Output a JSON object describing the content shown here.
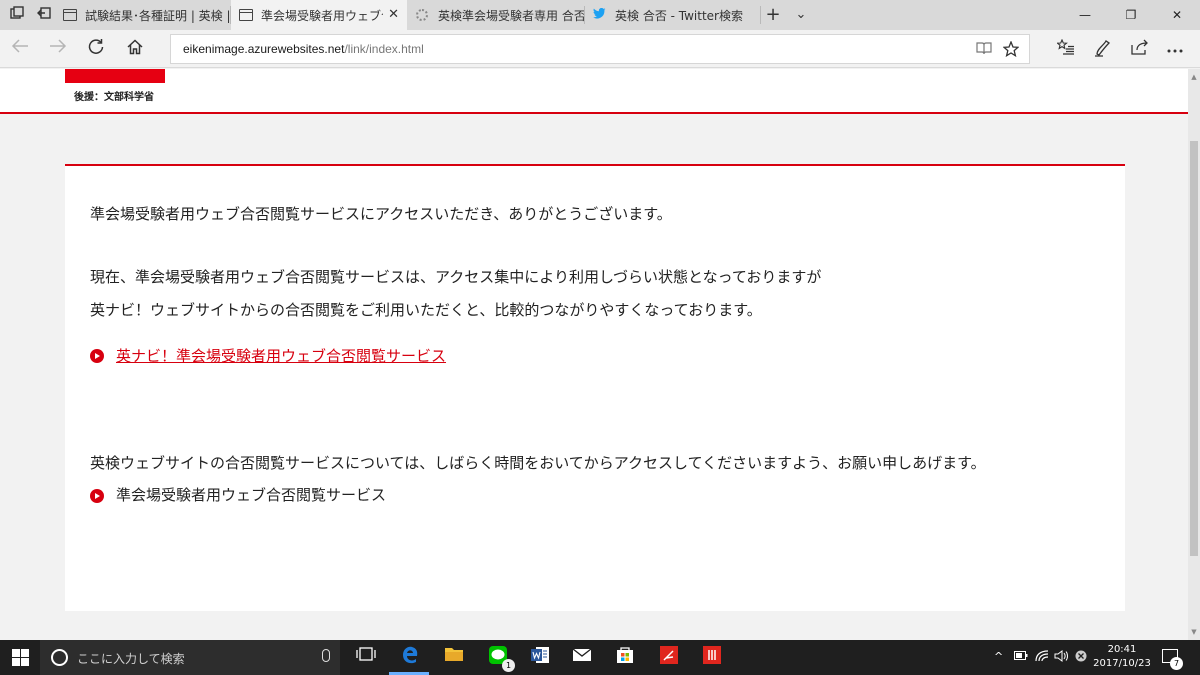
{
  "tabs": [
    {
      "title": "試験結果･各種証明 | 英検 |",
      "active": false
    },
    {
      "title": "準会場受験者用ウェブ合否",
      "active": true
    },
    {
      "title": "英検準会場受験者専用 合否",
      "active": false
    },
    {
      "title": "英検 合否 - Twitter検索",
      "active": false
    }
  ],
  "tabbar": {
    "close_glyph": "✕",
    "new_tab_glyph": "+",
    "tab_list_glyph": "⌄"
  },
  "window": {
    "minimize": "—",
    "restore": "❐",
    "close": "✕"
  },
  "address": {
    "host": "eikenimage.azurewebsites.net",
    "path": "/link/index.html"
  },
  "page": {
    "sponsor": "後援：文部科学省",
    "greeting": "準会場受験者用ウェブ合否閲覧サービスにアクセスいただき、ありがとうございます。",
    "notice_line1": "現在、準会場受験者用ウェブ合否閲覧サービスは、アクセス集中により利用しづらい状態となっておりますが",
    "notice_line2": "英ナビ！ウェブサイトからの合否閲覧をご利用いただくと、比較的つながりやすくなっております。",
    "link_eiken_navi": "英ナビ！準会場受験者用ウェブ合否閲覧サービス",
    "notice_line3": "英検ウェブサイトの合否閲覧サービスについては、しばらく時間をおいてからアクセスしてくださいますよう、お願い申しあげます。",
    "link_eiken_site": "準会場受験者用ウェブ合否閲覧サービス"
  },
  "taskbar": {
    "search_placeholder": "ここに入力して検索",
    "line_badge": "1",
    "clock_time": "20:41",
    "clock_date": "2017/10/23",
    "notification_count": "7"
  },
  "colors": {
    "accent": "#d7000f",
    "brand_red": "#e60012",
    "edge_blue": "#1e7ad8",
    "taskbar": "#1f1f1f"
  },
  "icons": [
    "tab-preview-icon",
    "set-aside-icon",
    "back-icon",
    "forward-icon",
    "refresh-icon",
    "home-icon",
    "reading-view-icon",
    "favorite-star-icon",
    "hub-icon",
    "web-note-icon",
    "share-icon",
    "more-icon"
  ]
}
